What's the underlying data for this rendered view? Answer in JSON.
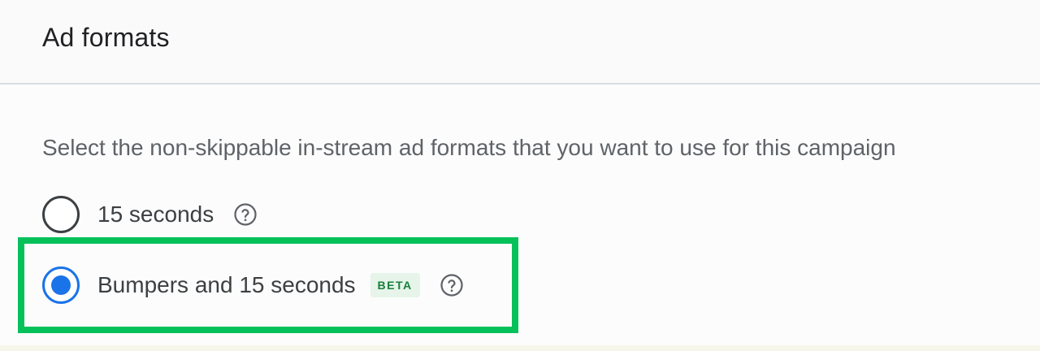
{
  "header": {
    "title": "Ad formats"
  },
  "main": {
    "description": "Select the non-skippable in-stream ad formats that you want to use for this campaign",
    "options": [
      {
        "label": "15 seconds",
        "selected": false,
        "help_icon": "help-circle-icon"
      },
      {
        "label": "Bumpers and 15 seconds",
        "selected": true,
        "badge": "BETA",
        "help_icon": "help-circle-icon"
      }
    ]
  },
  "colors": {
    "accent": "#1a73e8",
    "highlight": "#06c15a",
    "badge_bg": "#e6f4ea",
    "badge_text": "#188038"
  }
}
